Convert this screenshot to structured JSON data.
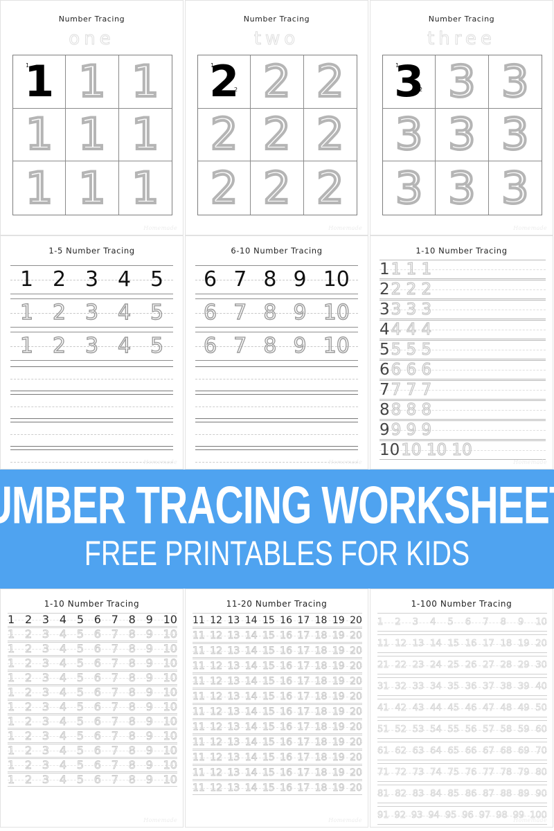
{
  "banner": {
    "title": "NUMBER TRACING WORKSHEETS",
    "subtitle": "FREE PRINTABLES FOR KIDS",
    "bg_color": "#4FA3F0",
    "text_color": "#FFFFFF"
  },
  "watermark": "Homemade",
  "worksheets": [
    {
      "id": "one",
      "title": "Number Tracing",
      "word": "one",
      "layout": "grid-3x3",
      "digit": "1",
      "stroke_labels": [
        "1"
      ],
      "cells": [
        "solid",
        "dotted",
        "dotted",
        "dotted",
        "dotted",
        "dotted",
        "dotted",
        "dotted",
        "dotted"
      ]
    },
    {
      "id": "two",
      "title": "Number Tracing",
      "word": "two",
      "layout": "grid-3x3",
      "digit": "2",
      "stroke_labels": [
        "1",
        "2"
      ],
      "cells": [
        "solid",
        "dotted",
        "dotted",
        "dotted",
        "dotted",
        "dotted",
        "dotted",
        "dotted",
        "dotted"
      ]
    },
    {
      "id": "three",
      "title": "Number Tracing",
      "word": "three",
      "layout": "grid-3x3",
      "digit": "3",
      "stroke_labels": [
        "1",
        "2"
      ],
      "cells": [
        "solid",
        "dotted",
        "dotted",
        "dotted",
        "dotted",
        "dotted",
        "dotted",
        "dotted",
        "dotted"
      ]
    },
    {
      "id": "1-5",
      "title": "1-5 Number Tracing",
      "layout": "ruled-bands",
      "numbers": [
        "1",
        "2",
        "3",
        "4",
        "5"
      ],
      "band_count": 3,
      "blank_band_count": 4
    },
    {
      "id": "6-10",
      "title": "6-10 Number Tracing",
      "layout": "ruled-bands",
      "numbers": [
        "6",
        "7",
        "8",
        "9",
        "10"
      ],
      "band_count": 3,
      "blank_band_count": 4
    },
    {
      "id": "1-10-list",
      "title": "1-10 Number Tracing",
      "layout": "list-rows",
      "rows": [
        {
          "lead": "1",
          "copies": "1 1 1"
        },
        {
          "lead": "2",
          "copies": "2 2 2"
        },
        {
          "lead": "3",
          "copies": "3 3 3"
        },
        {
          "lead": "4",
          "copies": "4 4 4"
        },
        {
          "lead": "5",
          "copies": "5 5 5"
        },
        {
          "lead": "6",
          "copies": "6 6 6"
        },
        {
          "lead": "7",
          "copies": "7 7 7"
        },
        {
          "lead": "8",
          "copies": "8 8 8"
        },
        {
          "lead": "9",
          "copies": "9 9 9"
        },
        {
          "lead": "10",
          "copies": "10 10 10"
        }
      ]
    },
    {
      "id": "1-10-table",
      "title": "1-10 Number Tracing",
      "layout": "table-rows",
      "header_row": [
        "1",
        "2",
        "3",
        "4",
        "5",
        "6",
        "7",
        "8",
        "9",
        "10"
      ],
      "repeat_row": [
        "1",
        "2",
        "3",
        "4",
        "5",
        "6",
        "7",
        "8",
        "9",
        "10"
      ],
      "repeat_count": 11
    },
    {
      "id": "11-20-table",
      "title": "11-20 Number Tracing",
      "layout": "table-rows",
      "header_row": [
        "11",
        "12",
        "13",
        "14",
        "15",
        "16",
        "17",
        "18",
        "19",
        "20"
      ],
      "repeat_row": [
        "11",
        "12",
        "13",
        "14",
        "15",
        "16",
        "17",
        "18",
        "19",
        "20"
      ],
      "repeat_count": 11
    },
    {
      "id": "1-100-table",
      "title": "1-100 Number Tracing",
      "layout": "table-rows-100",
      "rows": [
        [
          "1",
          "2",
          "3",
          "4",
          "5",
          "6",
          "7",
          "8",
          "9",
          "10"
        ],
        [
          "11",
          "12",
          "13",
          "14",
          "15",
          "16",
          "17",
          "18",
          "19",
          "20"
        ],
        [
          "21",
          "22",
          "23",
          "24",
          "25",
          "26",
          "27",
          "28",
          "29",
          "30"
        ],
        [
          "31",
          "32",
          "33",
          "34",
          "35",
          "36",
          "37",
          "38",
          "39",
          "40"
        ],
        [
          "41",
          "42",
          "43",
          "44",
          "45",
          "46",
          "47",
          "48",
          "49",
          "50"
        ],
        [
          "51",
          "52",
          "53",
          "54",
          "55",
          "56",
          "57",
          "58",
          "59",
          "60"
        ],
        [
          "61",
          "62",
          "63",
          "64",
          "65",
          "66",
          "67",
          "68",
          "69",
          "70"
        ],
        [
          "71",
          "72",
          "73",
          "74",
          "75",
          "76",
          "77",
          "78",
          "79",
          "80"
        ],
        [
          "81",
          "82",
          "83",
          "84",
          "85",
          "86",
          "87",
          "88",
          "89",
          "90"
        ],
        [
          "91",
          "92",
          "93",
          "94",
          "95",
          "96",
          "97",
          "98",
          "99",
          "100"
        ]
      ]
    }
  ]
}
